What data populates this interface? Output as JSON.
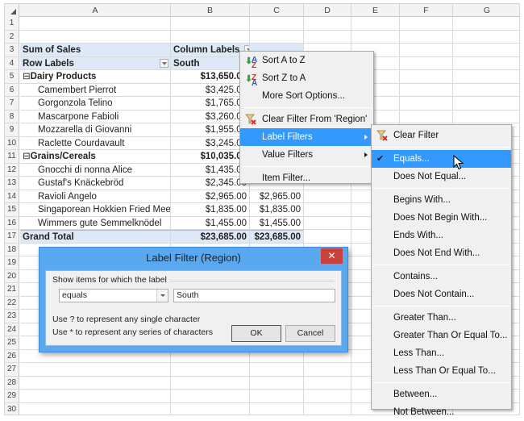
{
  "sheet": {
    "columns": [
      "A",
      "B",
      "C",
      "D",
      "E",
      "F",
      "G"
    ],
    "row_numbers": [
      "1",
      "2",
      "3",
      "4",
      "5",
      "6",
      "7",
      "8",
      "9",
      "10",
      "11",
      "12",
      "13",
      "14",
      "15",
      "16",
      "17",
      "18",
      "19",
      "20",
      "21",
      "22",
      "23",
      "24",
      "25",
      "26",
      "27",
      "28",
      "29",
      "30"
    ],
    "pivot": {
      "sum_label": "Sum of Sales",
      "column_labels": "Column Labels",
      "row_labels": "Row Labels",
      "col_header_value": "South",
      "rows": [
        {
          "label": "Dairy Products",
          "b": "$13,650.00",
          "c": "",
          "group": true
        },
        {
          "label": "Camembert Pierrot",
          "b": "$3,425.00",
          "c": ""
        },
        {
          "label": "Gorgonzola Telino",
          "b": "$1,765.00",
          "c": ""
        },
        {
          "label": "Mascarpone Fabioli",
          "b": "$3,260.00",
          "c": ""
        },
        {
          "label": "Mozzarella di Giovanni",
          "b": "$1,955.00",
          "c": ""
        },
        {
          "label": "Raclette Courdavault",
          "b": "$3,245.00",
          "c": ""
        },
        {
          "label": "Grains/Cereals",
          "b": "$10,035.00",
          "c": "",
          "group": true
        },
        {
          "label": "Gnocchi di nonna Alice",
          "b": "$1,435.00",
          "c": ""
        },
        {
          "label": "Gustaf's Knäckebröd",
          "b": "$2,345.00",
          "c": ""
        },
        {
          "label": "Ravioli Angelo",
          "b": "$2,965.00",
          "c": "$2,965.00"
        },
        {
          "label": "Singaporean Hokkien Fried Mee",
          "b": "$1,835.00",
          "c": "$1,835.00"
        },
        {
          "label": "Wimmers gute Semmelknödel",
          "b": "$1,455.00",
          "c": "$1,455.00"
        }
      ],
      "grand_total_label": "Grand Total",
      "grand_total_b": "$23,685.00",
      "grand_total_c": "$23,685.00",
      "collapse_glyph": "⊟"
    }
  },
  "context_menu": {
    "items": [
      {
        "label": "Sort A to Z",
        "icon": "sort-az-icon"
      },
      {
        "label": "Sort Z to A",
        "icon": "sort-za-icon"
      },
      {
        "label": "More Sort Options..."
      },
      {
        "label": "Clear Filter From 'Region'",
        "icon": "clear-filter-icon"
      },
      {
        "label": "Label Filters",
        "submenu": true,
        "selected": true
      },
      {
        "label": "Value Filters",
        "submenu": true
      },
      {
        "label": "Item Filter..."
      }
    ]
  },
  "label_filters_menu": {
    "items": [
      {
        "label": "Clear Filter",
        "icon": "clear-filter-icon"
      },
      {
        "label": "Equals...",
        "checked": true,
        "selected": true
      },
      {
        "label": "Does Not Equal..."
      },
      {
        "label": "Begins With..."
      },
      {
        "label": "Does Not Begin With..."
      },
      {
        "label": "Ends With..."
      },
      {
        "label": "Does Not End With..."
      },
      {
        "label": "Contains..."
      },
      {
        "label": "Does Not Contain..."
      },
      {
        "label": "Greater Than..."
      },
      {
        "label": "Greater Than Or Equal To..."
      },
      {
        "label": "Less Than..."
      },
      {
        "label": "Less Than Or Equal To..."
      },
      {
        "label": "Between..."
      },
      {
        "label": "Not Between..."
      }
    ],
    "check_glyph": "✔"
  },
  "dialog": {
    "title": "Label Filter (Region)",
    "close_glyph": "✕",
    "group_label": "Show items for which the label",
    "operator_value": "equals",
    "text_value": "South",
    "hint1": "Use ? to represent any single character",
    "hint2": "Use * to represent any series of characters",
    "ok_label": "OK",
    "cancel_label": "Cancel"
  },
  "colors": {
    "pivot_header_bg": "#dde9f7",
    "menu_highlight": "#3399ff",
    "dialog_frame": "#5aa8f0",
    "close_button": "#c9413b"
  }
}
